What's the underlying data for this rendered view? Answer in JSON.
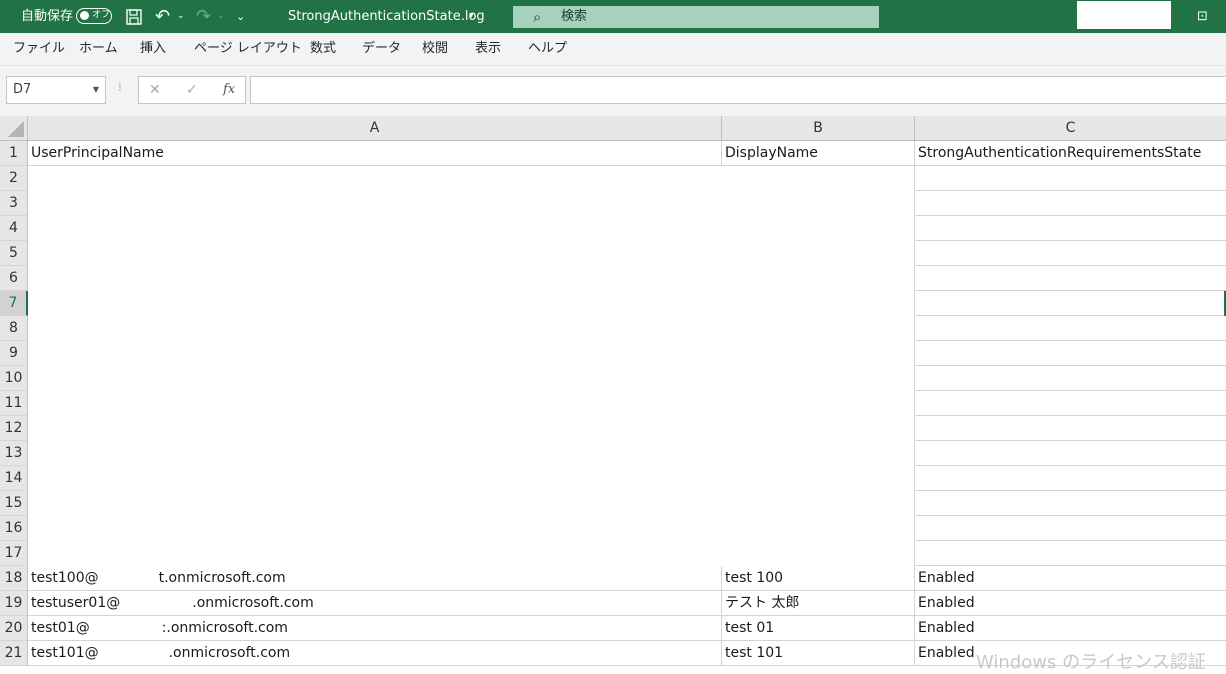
{
  "titlebar": {
    "autosave_label": "自動保存",
    "autosave_state": "オフ",
    "filename": "StrongAuthenticationState.log",
    "search_placeholder": "検索"
  },
  "menu": [
    "ファイル",
    "ホーム",
    "挿入",
    "ページ レイアウト",
    "数式",
    "データ",
    "校閲",
    "表示",
    "ヘルプ"
  ],
  "formula_bar": {
    "name_box": "D7",
    "formula": ""
  },
  "columns": [
    "A",
    "B",
    "C"
  ],
  "rows": [
    {
      "num": "1",
      "a": "UserPrincipalName",
      "b": "DisplayName",
      "c": "StrongAuthenticationRequirementsState"
    },
    {
      "num": "2",
      "a": "",
      "b": "",
      "c": ""
    },
    {
      "num": "3",
      "a": "",
      "b": "",
      "c": ""
    },
    {
      "num": "4",
      "a": "",
      "b": "",
      "c": ""
    },
    {
      "num": "5",
      "a": "",
      "b": "",
      "c": ""
    },
    {
      "num": "6",
      "a": "",
      "b": "",
      "c": ""
    },
    {
      "num": "7",
      "a": "",
      "b": "",
      "c": ""
    },
    {
      "num": "8",
      "a": "",
      "b": "",
      "c": ""
    },
    {
      "num": "9",
      "a": "",
      "b": "",
      "c": ""
    },
    {
      "num": "10",
      "a": "",
      "b": "",
      "c": ""
    },
    {
      "num": "11",
      "a": "",
      "b": "",
      "c": ""
    },
    {
      "num": "12",
      "a": "",
      "b": "",
      "c": ""
    },
    {
      "num": "13",
      "a": "",
      "b": "",
      "c": ""
    },
    {
      "num": "14",
      "a": "",
      "b": "",
      "c": ""
    },
    {
      "num": "15",
      "a": "",
      "b": "",
      "c": ""
    },
    {
      "num": "16",
      "a": "",
      "b": "",
      "c": ""
    },
    {
      "num": "17",
      "a": "",
      "b": "",
      "c": ""
    },
    {
      "num": "18",
      "a_user": "test100@",
      "a_domain": "t.onmicrosoft.com",
      "b": "test 100",
      "c": "Enabled"
    },
    {
      "num": "19",
      "a_user": "testuser01@",
      "a_domain": ".onmicrosoft.com",
      "b": "テスト 太郎",
      "c": "Enabled"
    },
    {
      "num": "20",
      "a_user": "test01@",
      "a_domain": ":.onmicrosoft.com",
      "b": "test 01",
      "c": "Enabled"
    },
    {
      "num": "21",
      "a_user": "test101@",
      "a_domain": ".onmicrosoft.com",
      "b": "test 101",
      "c": "Enabled"
    }
  ],
  "watermark": "Windows のライセンス認証",
  "colors": {
    "accent": "#217346",
    "header_bg": "#e6e6e6"
  }
}
